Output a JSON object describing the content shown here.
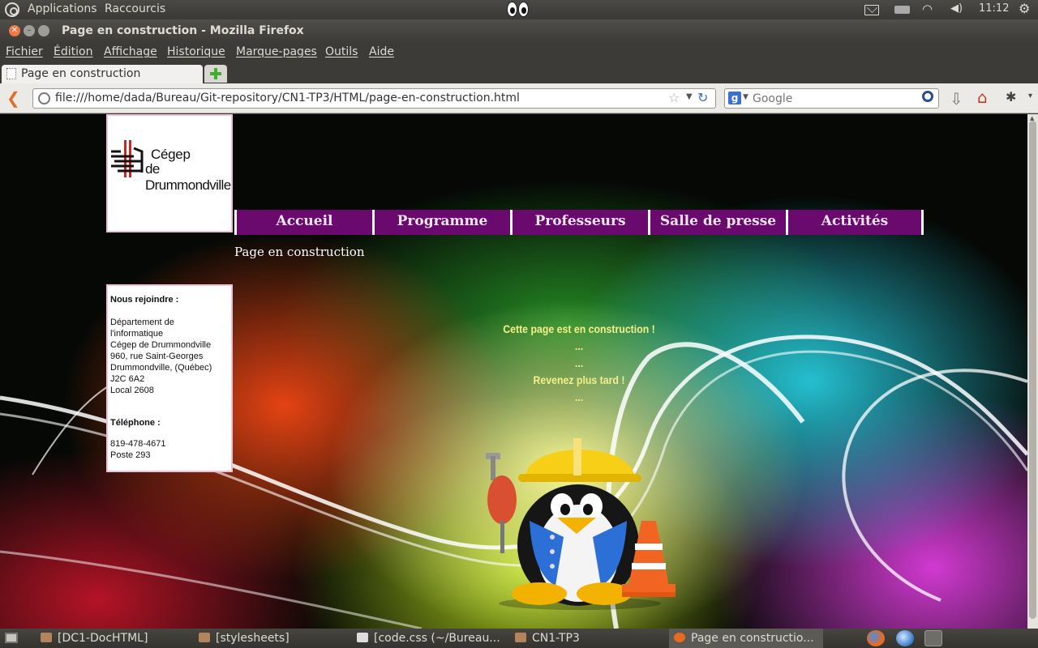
{
  "top_panel": {
    "apps_label": "Applications",
    "shortcuts_label": "Raccourcis",
    "clock": "11:12"
  },
  "window": {
    "title": "Page en construction - Mozilla Firefox"
  },
  "menubar": {
    "items": [
      "Fichier",
      "Édition",
      "Affichage",
      "Historique",
      "Marque-pages",
      "Outils",
      "Aide"
    ]
  },
  "tabs": [
    {
      "label": "Page en construction"
    }
  ],
  "navbar": {
    "url": "file:///home/dada/Bureau/Git-repository/CN1-TP3/HTML/page-en-construction.html",
    "search_placeholder": "Google"
  },
  "page": {
    "logo": {
      "line1": "Cégep",
      "line2": "de Drummondville"
    },
    "nav": [
      "Accueil",
      "Programme",
      "Professeurs",
      "Salle de presse",
      "Activités"
    ],
    "heading": "Page en construction",
    "contact": {
      "title": "Nous rejoindre :",
      "address": [
        "Département de l'informatique",
        "Cégep de Drummondville",
        "960, rue Saint-Georges",
        "Drummondville, (Québec)",
        "J2C 6A2",
        "Local 2608"
      ],
      "phone_title": "Téléphone :",
      "phone": [
        "819-478-4671",
        "Poste 293"
      ]
    },
    "message": {
      "line1": "Cette page est en construction !",
      "sep1": "...",
      "sep2": "...",
      "line2": "Revenez plus tard !",
      "sep3": "..."
    }
  },
  "taskbar": {
    "items": [
      {
        "label": "[DC1-DocHTML]",
        "icon": "folder-icon"
      },
      {
        "label": "[stylesheets]",
        "icon": "folder-icon"
      },
      {
        "label": "[code.css (~/Bureau...",
        "icon": "text-editor-icon"
      },
      {
        "label": "CN1-TP3",
        "icon": "folder-icon"
      },
      {
        "label": "Page en constructio...",
        "icon": "firefox-icon"
      }
    ]
  },
  "colors": {
    "nav_bg": "#6a0a6e",
    "message_color": "#f5ef8a",
    "panel_bg": "#3c3b37"
  }
}
